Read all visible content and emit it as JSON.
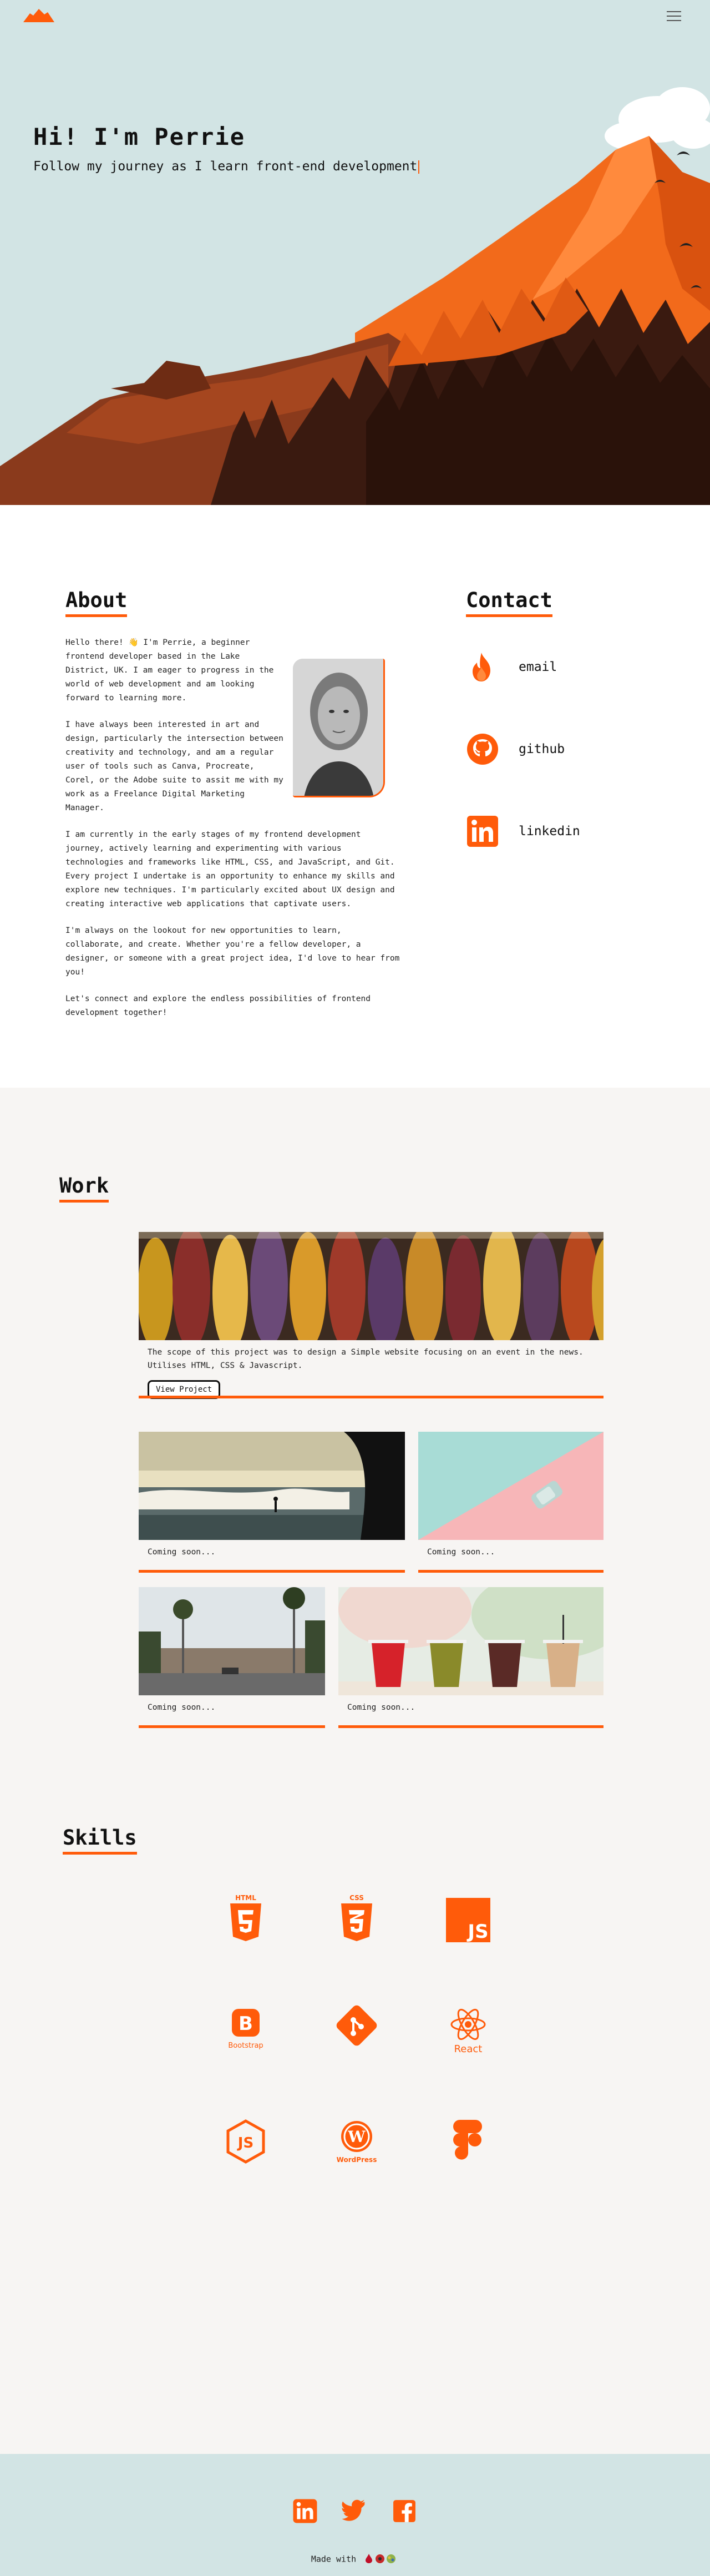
{
  "header": {
    "logo_icon": "mountain-logo-icon",
    "menu_icon": "hamburger-menu-icon"
  },
  "hero": {
    "title": "Hi! I'm Perrie",
    "subtitle": "Follow my journey as I learn front-end development"
  },
  "about": {
    "title": "About",
    "paragraphs": [
      "Hello there! 👋 I'm Perrie, a beginner frontend developer based in the Lake District, UK. I am eager to progress in the world of web development and am looking forward to learning more.",
      "I have always been interested in art and design, particularly the intersection between creativity and technology, and am a regular user of tools such as Canva, Procreate, Corel, or the Adobe suite to assit me with my work as a Freelance Digital Marketing Manager.",
      "I am currently in the early stages of my frontend development journey, actively learning and experimenting with various technologies and frameworks like HTML, CSS, and JavaScript, and Git. Every project I undertake is an opportunity to enhance my skills and explore new techniques. I'm particularly excited about UX design and creating interactive web applications that captivate users.",
      "I'm always on the lookout for new opportunities to learn, collaborate, and create. Whether you're a fellow developer, a designer, or someone with a great project idea, I'd love to hear from you!",
      "Let's connect and explore the endless possibilities of frontend development together!"
    ]
  },
  "contact": {
    "title": "Contact",
    "items": [
      {
        "label": "email",
        "icon": "email-flame-icon"
      },
      {
        "label": "github",
        "icon": "github-icon"
      },
      {
        "label": "linkedin",
        "icon": "linkedin-icon"
      }
    ]
  },
  "work": {
    "title": "Work",
    "featured": {
      "caption": "The scope of this project was to design a Simple website focusing on an event in the news. Utilises HTML, CSS & Javascript.",
      "button": "View Project"
    },
    "coming_soon": [
      "Coming soon...",
      "Coming soon...",
      "Coming soon...",
      "Coming soon..."
    ]
  },
  "skills": {
    "title": "Skills",
    "items": [
      {
        "name": "HTML",
        "icon": "html5-icon"
      },
      {
        "name": "CSS",
        "icon": "css3-icon"
      },
      {
        "name": "JS",
        "icon": "javascript-icon"
      },
      {
        "name": "Bootstrap",
        "icon": "bootstrap-icon"
      },
      {
        "name": "Git",
        "icon": "git-icon"
      },
      {
        "name": "React",
        "icon": "react-icon"
      },
      {
        "name": "Node",
        "icon": "nodejs-icon"
      },
      {
        "name": "WordPress",
        "icon": "wordpress-icon"
      },
      {
        "name": "Figma",
        "icon": "figma-icon"
      }
    ]
  },
  "footer": {
    "social": [
      "linkedin-icon",
      "twitter-icon",
      "facebook-icon"
    ],
    "made_with": "Made with"
  },
  "colors": {
    "accent": "#ff5b0a",
    "hero_bg": "#d2e4e4",
    "work_bg": "#f7f5f3"
  }
}
